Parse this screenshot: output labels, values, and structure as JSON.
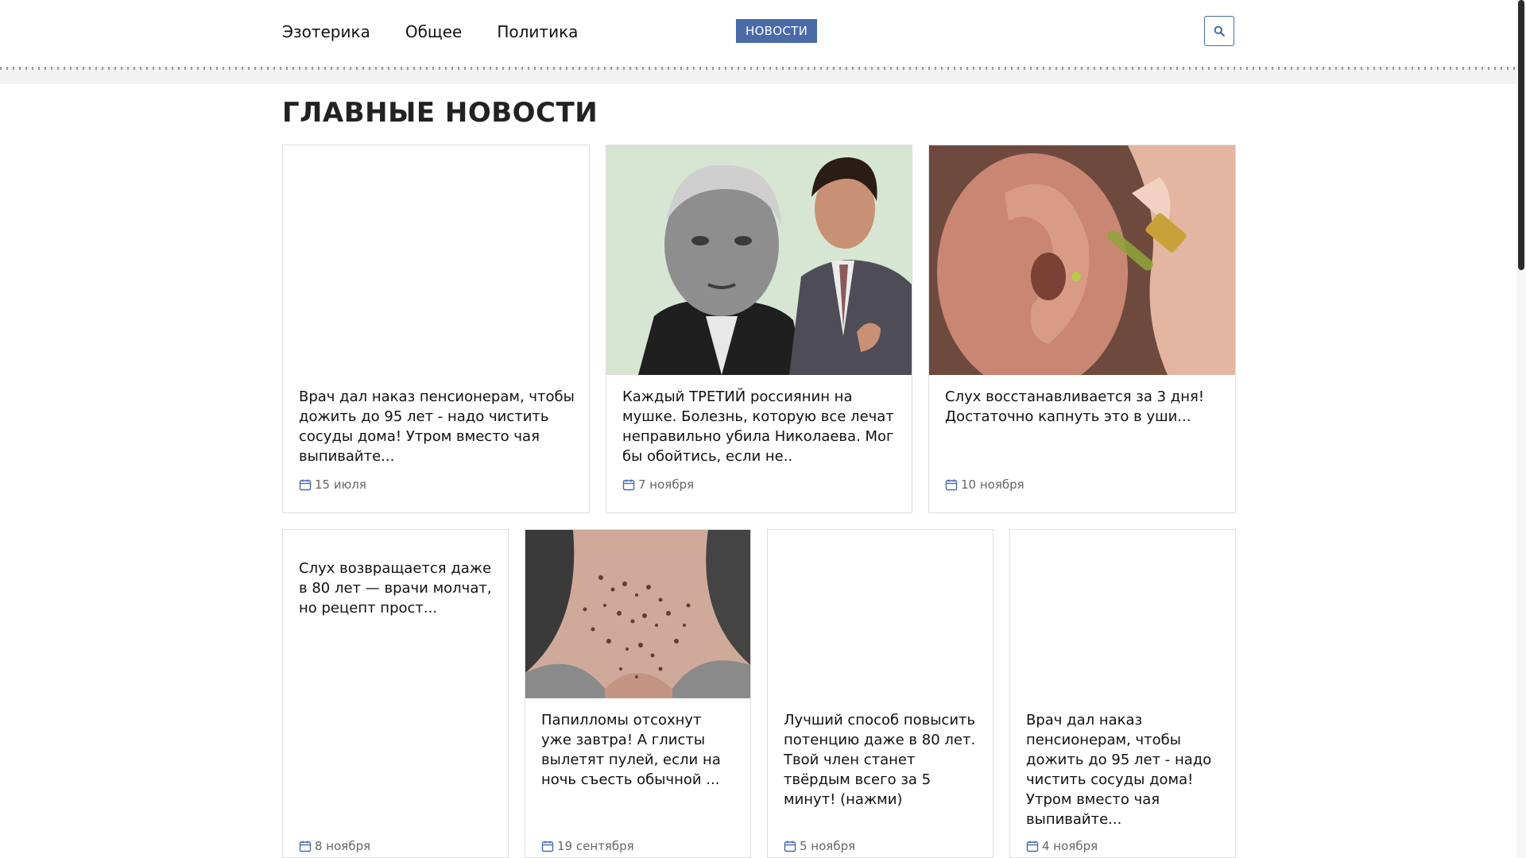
{
  "nav": {
    "items": [
      "Эзотерика",
      "Общее",
      "Политика"
    ],
    "badge": "НОВОСТИ"
  },
  "section_title": "ГЛАВНЫЕ НОВОСТИ",
  "colors": {
    "accent": "#4a6aa8",
    "card_border": "#dedede",
    "date_text": "#666666"
  },
  "icons": {
    "search": "search-icon",
    "calendar": "calendar-icon"
  },
  "cards": [
    {
      "title": "Врач дал наказ пенсионерам, чтобы дожить до 95 лет - надо чистить сосуды дома! Утром вместо чая выпивайте...",
      "date": "15 июля"
    },
    {
      "title": "Каждый ТРЕТИЙ россиянин на мушке. Болезнь, которую все лечат неправильно убила Николаева. Мог бы обойтись, если не..",
      "date": "7 ноября"
    },
    {
      "title": "Слух восстанавливается за 3 дня! Достаточно капнуть это в уши...",
      "date": "10 ноября"
    },
    {
      "title": "Слух возвращается даже в 80 лет — врачи молчат, но рецепт прост...",
      "date": "8 ноября"
    },
    {
      "title": "Папилломы отсохнут уже завтра! А глисты вылетят пулей, если на ночь съесть обычной ...",
      "date": "19 сентября"
    },
    {
      "title": "Лучший способ повысить потенцию даже в 80 лет. Твой член станет твёрдым всего за 5 минут! (нажми)",
      "date": "5 ноября"
    },
    {
      "title": "Врач дал наказ пенсионерам, чтобы дожить до 95 лет - надо чистить сосуды дома! Утром вместо чая выпивайте...",
      "date": "4 ноября"
    }
  ]
}
